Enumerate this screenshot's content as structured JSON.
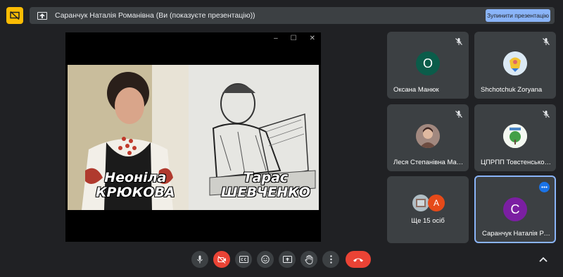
{
  "top_bar": {
    "presentation_text": "Саранчук Наталія Романівна (Ви (показуєте презентацію))",
    "stop_button_label": "Зупинити презентацію"
  },
  "slide": {
    "left_caption_line1": "Неоніла",
    "left_caption_line2": "КРЮКОВА",
    "right_caption_line1": "Тарас",
    "right_caption_line2": "ШЕВЧЕНКО"
  },
  "window_controls": {
    "minimize": "–",
    "maximize": "☐",
    "close": "✕"
  },
  "participants": [
    {
      "name": "Оксана Манюк",
      "initial": "О",
      "avatar_color": "#0b5c4a",
      "muted": true
    },
    {
      "name": "Shchotchuk Zoryana",
      "initial": "",
      "avatar_color": "#f1d14a",
      "muted": true
    },
    {
      "name": "Леся Степанівна Мац...",
      "initial": "",
      "avatar_color": "#8d6e63",
      "muted": true
    },
    {
      "name": "ЦПРПП Товстенської ...",
      "initial": "",
      "avatar_color": "#e8f0e8",
      "muted": true
    },
    {
      "name": "Ще 15 осіб",
      "initial": "А",
      "avatar_color": "#e64a19",
      "muted": false
    },
    {
      "name": "Саранчук Наталія Ро...",
      "initial": "С",
      "avatar_color": "#7b1fa2",
      "muted": false
    }
  ],
  "colors": {
    "accent": "#8ab4f8",
    "end_call": "#ea4335",
    "yellow": "#fbbc04"
  }
}
